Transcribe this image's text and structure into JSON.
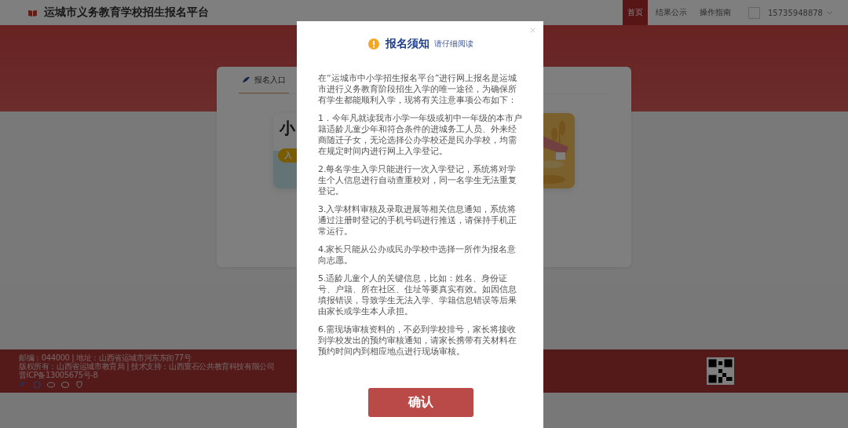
{
  "header": {
    "title": "运城市义务教育学校招生报名平台",
    "nav": [
      {
        "label": "首页",
        "selected": true
      },
      {
        "label": "结果公示",
        "selected": false
      },
      {
        "label": "操作指南",
        "selected": false
      }
    ],
    "user": {
      "phone": "15735948878"
    }
  },
  "entry_panel": {
    "tabs": [
      {
        "label": "报名入口",
        "selected": true
      }
    ],
    "card": {
      "title": "小",
      "badge": "入"
    }
  },
  "footer": {
    "lines": [
      "邮编：044000 | 地址：山西省运城市河东东街77号",
      "版权所有：山西省运城市教育局 | 技术支持：山西寰石公共教育科技有限公司",
      "晋ICP备13005675号-8"
    ]
  },
  "modal": {
    "title": "报名须知",
    "subtitle": "请仔细阅读",
    "paragraphs": [
      "在“运城市中小学招生报名平台”进行网上报名是运城市进行义务教育阶段招生入学的唯一途径，为确保所有学生都能顺利入学，现将有关注意事项公布如下：",
      "1．今年凡就读我市小学一年级或初中一年级的本市户籍适龄儿童少年和符合条件的进城务工人员、外来经商随迁子女，无论选择公办学校还是民办学校，均需在规定时间内进行网上入学登记。",
      "2.每名学生入学只能进行一次入学登记，系统将对学生个人信息进行自动查重校对，同一名学生无法重复登记。",
      "3.入学材料审核及录取进展等相关信息通知，系统将通过注册时登记的手机号码进行推送，请保持手机正常运行。",
      "4.家长只能从公办或民办学校中选择一所作为报名意向志愿。",
      "5.适龄儿童个人的关键信息，比如：姓名、身份证号、户籍、所在社区、住址等要真实有效。如因信息填报错误，导致学生无法入学、学籍信息错误等后果由家长或学生本人承担。",
      "6.需现场审核资料的，不必到学校排号，家长将接收到学校发出的预约审核通知，请家长携带有关材料在预约时间内到相应地点进行现场审核。"
    ],
    "button": "确认"
  }
}
